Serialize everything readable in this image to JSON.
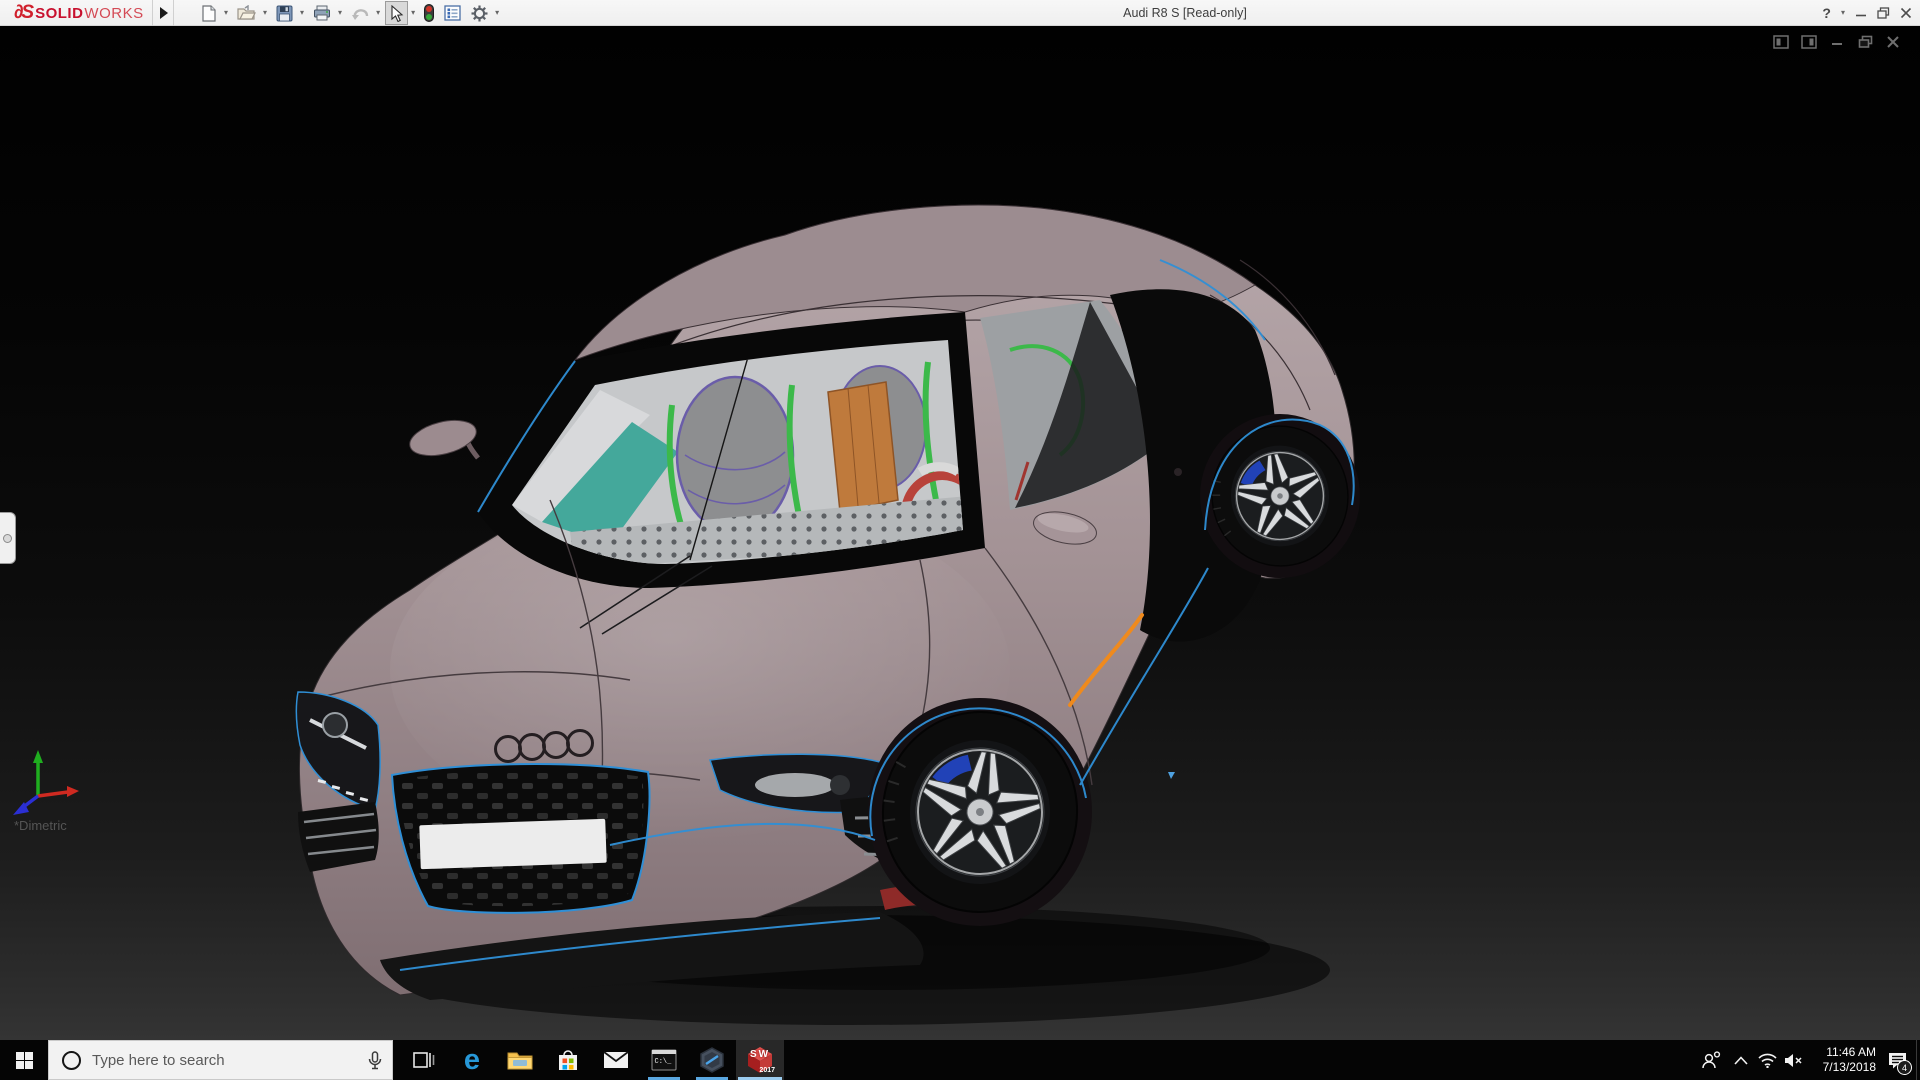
{
  "titlebar": {
    "logo_mark": "∂S",
    "logo_bold": "SOLID",
    "logo_light": "WORKS",
    "title": "Audi R8 S [Read-only]",
    "help_glyph": "?"
  },
  "icons": {
    "caret": "▾",
    "edge_letter": "e",
    "cmd_prompt": "C:\\_",
    "toolbar": [
      "new-document",
      "open",
      "save",
      "print",
      "undo",
      "select",
      "rebuild",
      "file-properties",
      "options"
    ],
    "document_controls": [
      "pane-toggle-left",
      "pane-toggle-right",
      "minimize",
      "restore",
      "close"
    ],
    "tray": [
      "people",
      "hidden-icons-chevron",
      "wifi",
      "volume-muted",
      "action-center"
    ]
  },
  "viewport": {
    "orientation_label": "*Dimetric"
  },
  "taskbar": {
    "search_placeholder": "Type here to search",
    "apps": [
      "start",
      "task-view",
      "edge",
      "file-explorer",
      "store",
      "mail",
      "command-prompt",
      "edrawings",
      "solidworks-2017"
    ],
    "solidworks_badge_top": "SW",
    "solidworks_badge_year": "2017",
    "clock_time": "11:46 AM",
    "clock_date": "7/13/2018",
    "notification_count": "4"
  },
  "colors": {
    "selection_blue": "#2f8fd6",
    "highlight_orange": "#ef8a1d",
    "body_mauve": "#a79699",
    "belt_green": "#3cb94a",
    "interior_teal": "#44a89b",
    "interior_orange": "#bf7a3c",
    "wheel_silver": "#d8dadc",
    "titlebar_bg": "#f2f2f2",
    "taskbar_bg": "#050505"
  }
}
